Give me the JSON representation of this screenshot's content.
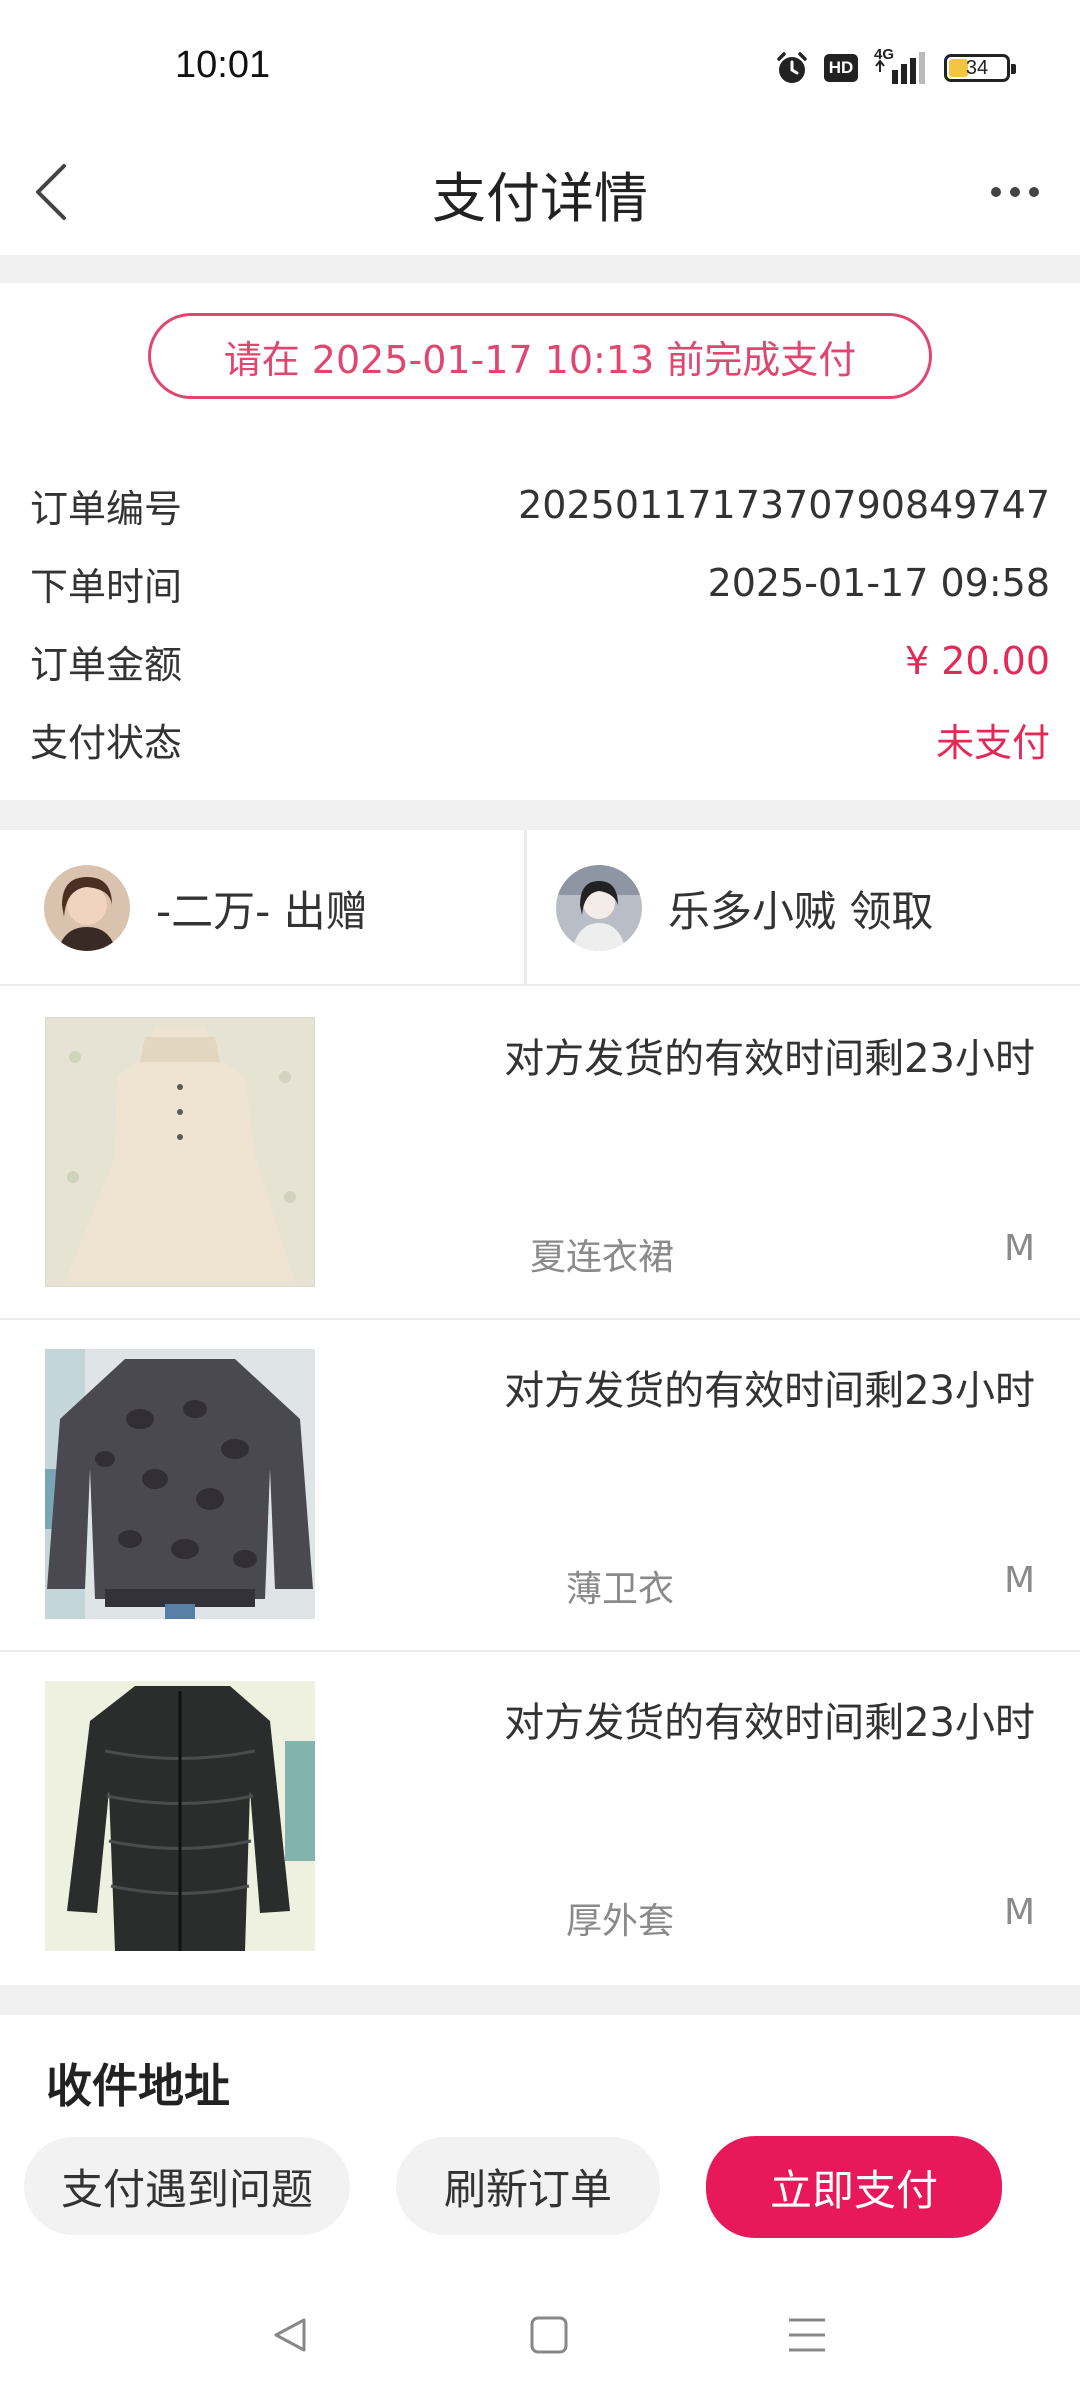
{
  "status_bar": {
    "time": "10:01",
    "network": "4G",
    "hd_badge": "HD",
    "battery": "34",
    "battery_level": 0.34
  },
  "nav": {
    "title": "支付详情"
  },
  "deadline_text": "请在 2025-01-17 10:13 前完成支付",
  "order_info": [
    {
      "label": "订单编号",
      "value": "20250117173707908497​47"
    },
    {
      "label": "下单时间",
      "value": "2025-01-17 09:58"
    },
    {
      "label": "订单金额",
      "value": "¥ 20.00"
    },
    {
      "label": "支付状态",
      "value": "未支付"
    }
  ],
  "parties": {
    "giver": "-二万- 出赠",
    "receiver": "乐多小贼 领取"
  },
  "items": [
    {
      "deadline": "对方发货的有效时间剩23小时",
      "name": "夏连衣裙",
      "size": "M"
    },
    {
      "deadline": "对方发货的有效时间剩23小时",
      "name": "薄卫衣",
      "size": "M"
    },
    {
      "deadline": "对方发货的有效时间剩23小时",
      "name": "厚外套",
      "size": "M"
    }
  ],
  "address": {
    "title": "收件地址"
  },
  "buttons": {
    "problem": "支付遇到问题",
    "refresh": "刷新订单",
    "pay": "立即支付"
  },
  "colors": {
    "accent": "#e8195a",
    "accent_text": "#e32957",
    "deadline_border": "#e0466f",
    "divider": "#f0f0f0"
  }
}
